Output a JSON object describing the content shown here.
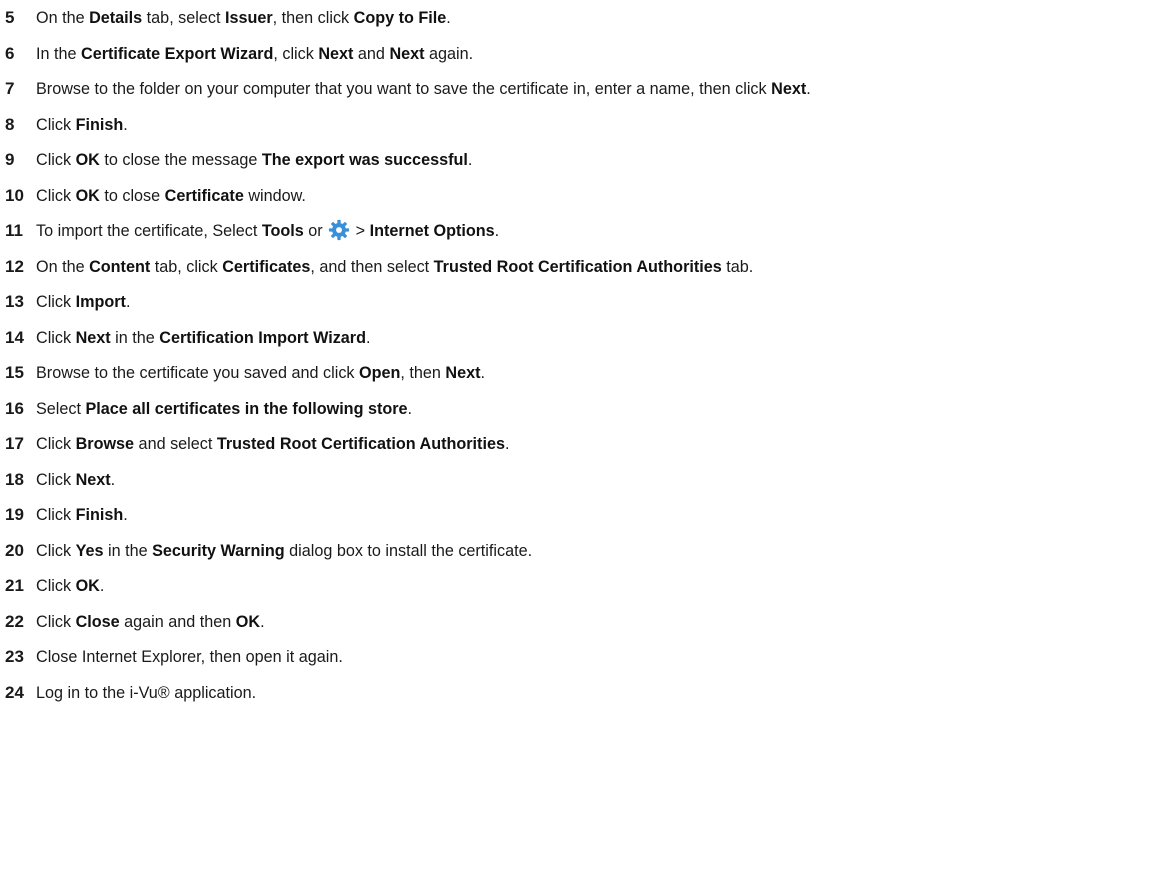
{
  "steps": [
    {
      "num": "5",
      "parts": [
        {
          "t": "On the "
        },
        {
          "t": "Details",
          "b": true
        },
        {
          "t": " tab, select "
        },
        {
          "t": "Issuer",
          "b": true
        },
        {
          "t": ", then click "
        },
        {
          "t": "Copy to File",
          "b": true
        },
        {
          "t": "."
        }
      ]
    },
    {
      "num": "6",
      "parts": [
        {
          "t": "In the "
        },
        {
          "t": "Certificate Export Wizard",
          "b": true
        },
        {
          "t": ", click "
        },
        {
          "t": "Next",
          "b": true
        },
        {
          "t": " and "
        },
        {
          "t": "Next",
          "b": true
        },
        {
          "t": " again."
        }
      ]
    },
    {
      "num": "7",
      "parts": [
        {
          "t": "Browse to the folder on your computer that you want to save the certificate in, enter a name, then click "
        },
        {
          "t": "Next",
          "b": true
        },
        {
          "t": "."
        }
      ]
    },
    {
      "num": "8",
      "parts": [
        {
          "t": "Click "
        },
        {
          "t": "Finish",
          "b": true
        },
        {
          "t": "."
        }
      ]
    },
    {
      "num": "9",
      "parts": [
        {
          "t": "Click "
        },
        {
          "t": "OK",
          "b": true
        },
        {
          "t": " to close the message "
        },
        {
          "t": "The export was successful",
          "b": true
        },
        {
          "t": "."
        }
      ]
    },
    {
      "num": "10",
      "parts": [
        {
          "t": "Click "
        },
        {
          "t": "OK",
          "b": true
        },
        {
          "t": " to close "
        },
        {
          "t": "Certificate",
          "b": true
        },
        {
          "t": " window."
        }
      ]
    },
    {
      "num": "11",
      "parts": [
        {
          "t": "To import the certificate, Select "
        },
        {
          "t": "Tools",
          "b": true
        },
        {
          "t": " or "
        },
        {
          "icon": "gear-icon"
        },
        {
          "t": " > "
        },
        {
          "t": "Internet Options",
          "b": true
        },
        {
          "t": "."
        }
      ]
    },
    {
      "num": "12",
      "parts": [
        {
          "t": "On the "
        },
        {
          "t": "Content",
          "b": true
        },
        {
          "t": " tab, click "
        },
        {
          "t": "Certificates",
          "b": true
        },
        {
          "t": ", and then select "
        },
        {
          "t": "Trusted Root Certification Authorities",
          "b": true
        },
        {
          "t": " tab."
        }
      ]
    },
    {
      "num": "13",
      "parts": [
        {
          "t": "Click "
        },
        {
          "t": "Import",
          "b": true
        },
        {
          "t": "."
        }
      ]
    },
    {
      "num": "14",
      "parts": [
        {
          "t": "Click "
        },
        {
          "t": "Next",
          "b": true
        },
        {
          "t": " in the "
        },
        {
          "t": "Certification Import Wizard",
          "b": true
        },
        {
          "t": "."
        }
      ]
    },
    {
      "num": "15",
      "parts": [
        {
          "t": "Browse to the certificate you saved and click "
        },
        {
          "t": "Open",
          "b": true
        },
        {
          "t": ", then "
        },
        {
          "t": "Next",
          "b": true
        },
        {
          "t": "."
        }
      ]
    },
    {
      "num": "16",
      "parts": [
        {
          "t": "Select "
        },
        {
          "t": "Place all certificates in the following store",
          "b": true
        },
        {
          "t": "."
        }
      ]
    },
    {
      "num": "17",
      "parts": [
        {
          "t": "Click "
        },
        {
          "t": "Browse",
          "b": true
        },
        {
          "t": " and select "
        },
        {
          "t": "Trusted Root Certification Authorities",
          "b": true
        },
        {
          "t": "."
        }
      ]
    },
    {
      "num": "18",
      "parts": [
        {
          "t": "Click "
        },
        {
          "t": "Next",
          "b": true
        },
        {
          "t": "."
        }
      ]
    },
    {
      "num": "19",
      "parts": [
        {
          "t": "Click "
        },
        {
          "t": "Finish",
          "b": true
        },
        {
          "t": "."
        }
      ]
    },
    {
      "num": "20",
      "parts": [
        {
          "t": "Click "
        },
        {
          "t": "Yes",
          "b": true
        },
        {
          "t": " in the "
        },
        {
          "t": "Security Warning",
          "b": true
        },
        {
          "t": " dialog box to install the certificate."
        }
      ]
    },
    {
      "num": "21",
      "parts": [
        {
          "t": "Click "
        },
        {
          "t": "OK",
          "b": true
        },
        {
          "t": "."
        }
      ]
    },
    {
      "num": "22",
      "parts": [
        {
          "t": "Click "
        },
        {
          "t": "Close",
          "b": true
        },
        {
          "t": " again and then "
        },
        {
          "t": "OK",
          "b": true
        },
        {
          "t": "."
        }
      ]
    },
    {
      "num": "23",
      "parts": [
        {
          "t": "Close Internet Explorer, then open it again."
        }
      ]
    },
    {
      "num": "24",
      "parts": [
        {
          "t": "Log in to the i-Vu® application."
        }
      ]
    }
  ],
  "colors": {
    "text": "#1a1a1a",
    "gear_icon": "#3a8fd9"
  }
}
